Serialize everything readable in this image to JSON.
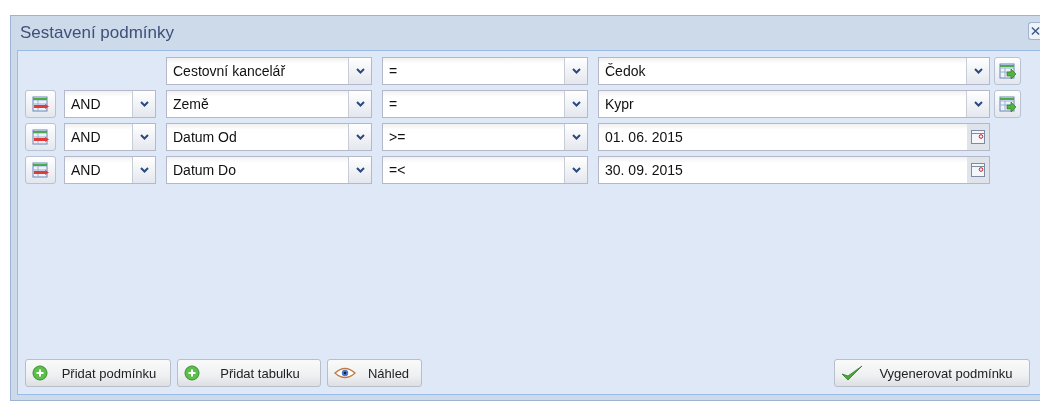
{
  "window": {
    "title": "Sestavení podmínky"
  },
  "conditions": [
    {
      "field": "Cestovní kancelář",
      "operator": "=",
      "value": "Čedok",
      "kind": "select"
    },
    {
      "conjunction": "AND",
      "field": "Země",
      "operator": "=",
      "value": "Kypr",
      "kind": "select"
    },
    {
      "conjunction": "AND",
      "field": "Datum Od",
      "operator": ">=",
      "value": "01. 06. 2015",
      "kind": "date"
    },
    {
      "conjunction": "AND",
      "field": "Datum Do",
      "operator": "=<",
      "value": "30. 09. 2015",
      "kind": "date"
    }
  ],
  "buttons": [
    {
      "label": "Přidat podmínku",
      "kind": "add"
    },
    {
      "label": "Přidat tabulku",
      "kind": "add"
    },
    {
      "label": "Náhled",
      "kind": "preview"
    },
    {
      "label": "Vygenerovat podmínku",
      "kind": "confirm"
    }
  ]
}
